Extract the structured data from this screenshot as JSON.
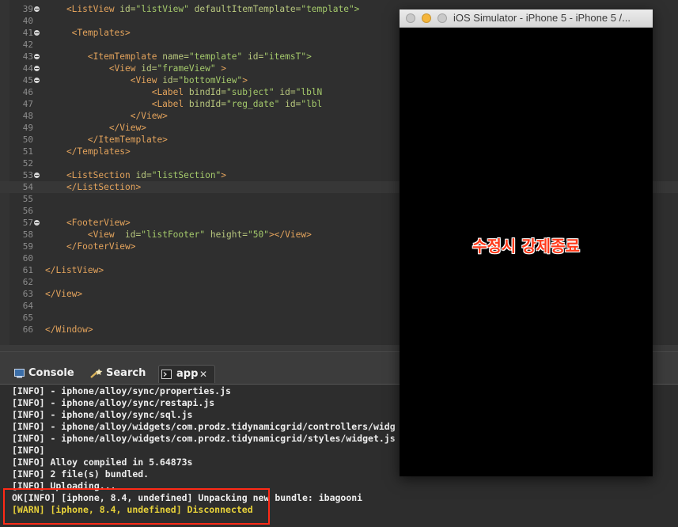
{
  "editor": {
    "lines": [
      {
        "n": "39",
        "fold": true,
        "parts": [
          [
            "t",
            "    <ListView "
          ],
          [
            "a",
            "id="
          ],
          [
            "s",
            "\"listView\""
          ],
          [
            "a",
            " defaultItemTemplate="
          ],
          [
            "s",
            "\"template\">"
          ]
        ]
      },
      {
        "n": "40",
        "fold": false,
        "parts": []
      },
      {
        "n": "41",
        "fold": true,
        "parts": [
          [
            "t",
            "     <Templates>"
          ]
        ]
      },
      {
        "n": "42",
        "fold": false,
        "parts": []
      },
      {
        "n": "43",
        "fold": true,
        "parts": [
          [
            "t",
            "        <ItemTemplate "
          ],
          [
            "a",
            "name="
          ],
          [
            "s",
            "\"template\""
          ],
          [
            "a",
            " id="
          ],
          [
            "s",
            "\"itemsT\">"
          ]
        ]
      },
      {
        "n": "44",
        "fold": true,
        "parts": [
          [
            "t",
            "            <View "
          ],
          [
            "a",
            "id="
          ],
          [
            "s",
            "\"frameView\""
          ],
          [
            "t",
            " >"
          ]
        ]
      },
      {
        "n": "45",
        "fold": true,
        "parts": [
          [
            "t",
            "                <View "
          ],
          [
            "a",
            "id="
          ],
          [
            "s",
            "\"bottomView\""
          ],
          [
            "t",
            ">"
          ]
        ]
      },
      {
        "n": "46",
        "fold": false,
        "parts": [
          [
            "t",
            "                    <Label "
          ],
          [
            "a",
            "bindId="
          ],
          [
            "s",
            "\"subject\""
          ],
          [
            "a",
            " id="
          ],
          [
            "s",
            "\"lblN"
          ]
        ]
      },
      {
        "n": "47",
        "fold": false,
        "parts": [
          [
            "t",
            "                    <Label "
          ],
          [
            "a",
            "bindId="
          ],
          [
            "s",
            "\"reg_date\""
          ],
          [
            "a",
            " id="
          ],
          [
            "s",
            "\"lbl"
          ]
        ]
      },
      {
        "n": "48",
        "fold": false,
        "parts": [
          [
            "t",
            "                </View>"
          ]
        ]
      },
      {
        "n": "49",
        "fold": false,
        "parts": [
          [
            "t",
            "            </View>"
          ]
        ]
      },
      {
        "n": "50",
        "fold": false,
        "parts": [
          [
            "t",
            "        </ItemTemplate>"
          ]
        ]
      },
      {
        "n": "51",
        "fold": false,
        "parts": [
          [
            "t",
            "    </Templates>"
          ]
        ]
      },
      {
        "n": "52",
        "fold": false,
        "parts": []
      },
      {
        "n": "53",
        "fold": true,
        "parts": [
          [
            "t",
            "    <ListSection "
          ],
          [
            "a",
            "id="
          ],
          [
            "s",
            "\"listSection\""
          ],
          [
            "t",
            ">"
          ]
        ]
      },
      {
        "n": "54",
        "fold": false,
        "parts": [
          [
            "t",
            "    </ListSection>"
          ]
        ],
        "current": true
      },
      {
        "n": "55",
        "fold": false,
        "parts": []
      },
      {
        "n": "56",
        "fold": false,
        "parts": []
      },
      {
        "n": "57",
        "fold": true,
        "parts": [
          [
            "t",
            "    <FooterView>"
          ]
        ]
      },
      {
        "n": "58",
        "fold": false,
        "parts": [
          [
            "t",
            "        <View  "
          ],
          [
            "a",
            "id="
          ],
          [
            "s",
            "\"listFooter\""
          ],
          [
            "a",
            " height="
          ],
          [
            "s",
            "\"50\""
          ],
          [
            "t",
            "></View>"
          ]
        ]
      },
      {
        "n": "59",
        "fold": false,
        "parts": [
          [
            "t",
            "    </FooterView>"
          ]
        ]
      },
      {
        "n": "60",
        "fold": false,
        "parts": []
      },
      {
        "n": "61",
        "fold": false,
        "parts": [
          [
            "t",
            "</ListView>"
          ]
        ]
      },
      {
        "n": "62",
        "fold": false,
        "parts": []
      },
      {
        "n": "63",
        "fold": false,
        "parts": [
          [
            "t",
            "</View>"
          ]
        ]
      },
      {
        "n": "64",
        "fold": false,
        "parts": []
      },
      {
        "n": "65",
        "fold": false,
        "parts": []
      },
      {
        "n": "66",
        "fold": false,
        "parts": [
          [
            "t",
            "</Window>"
          ]
        ]
      }
    ]
  },
  "panel": {
    "tabs": [
      {
        "label": "Console",
        "icon": "console-icon"
      },
      {
        "label": "Search",
        "icon": "search-wand-icon"
      },
      {
        "label": "app",
        "icon": "app-terminal-icon",
        "close": "✕"
      }
    ]
  },
  "console": {
    "lines": [
      {
        "text": "[INFO] - iphone/alloy/sync/properties.js",
        "level": "info"
      },
      {
        "text": "[INFO] - iphone/alloy/sync/restapi.js",
        "level": "info"
      },
      {
        "text": "[INFO] - iphone/alloy/sync/sql.js",
        "level": "info"
      },
      {
        "text": "[INFO] - iphone/alloy/widgets/com.prodz.tidynamicgrid/controllers/widg",
        "level": "info"
      },
      {
        "text": "[INFO] - iphone/alloy/widgets/com.prodz.tidynamicgrid/styles/widget.js",
        "level": "info"
      },
      {
        "text": "[INFO]",
        "level": "info"
      },
      {
        "text": "[INFO] Alloy compiled in 5.64873s",
        "level": "info"
      },
      {
        "text": "[INFO] 2 file(s) bundled.",
        "level": "info"
      },
      {
        "text": "[INFO] Uploading...",
        "level": "info"
      },
      {
        "text": "OK[INFO] [iphone, 8.4, undefined] Unpacking new bundle: ibagooni",
        "level": "info"
      },
      {
        "text": "[WARN] [iphone, 8.4, undefined] Disconnected",
        "level": "warn"
      }
    ]
  },
  "simulator": {
    "title": "iOS Simulator - iPhone 5 - iPhone 5 /...",
    "traffic_lights": [
      "#c9c9c9",
      "#f5b53a",
      "#c9c9c9"
    ],
    "overlay_caption": "수정시 강제종료"
  },
  "colors": {
    "annotation_red": "#ff2a16",
    "warn_yellow": "#e8d23a"
  }
}
